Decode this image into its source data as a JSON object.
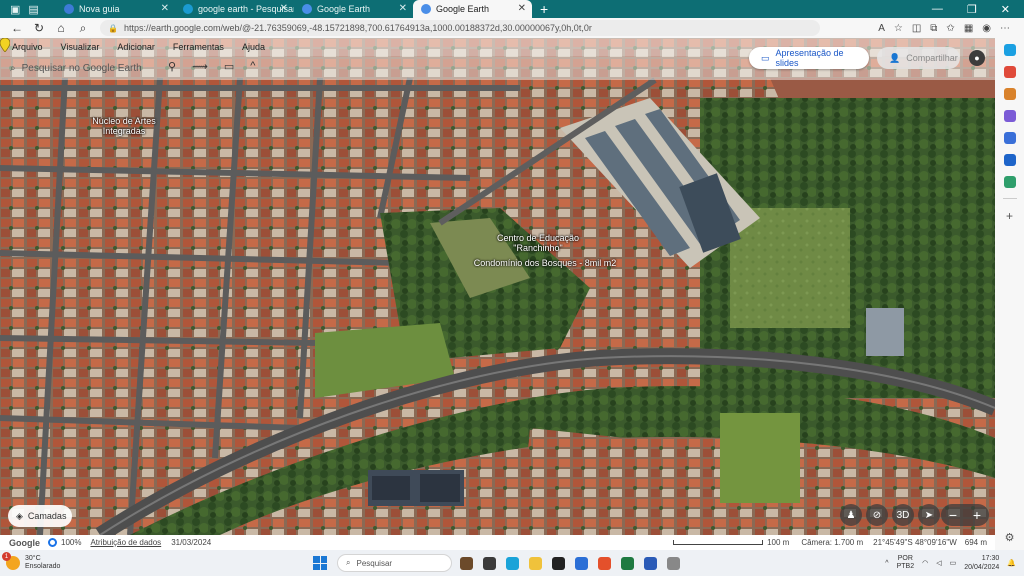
{
  "browser": {
    "tabs": [
      {
        "title": "Nova guia",
        "color": "#3d7bd6"
      },
      {
        "title": "google earth - Pesquisar",
        "color": "#1b9bd1"
      },
      {
        "title": "Google Earth",
        "color": "#4a8ee8"
      },
      {
        "title": "Google Earth",
        "color": "#4a8ee8"
      }
    ],
    "new_tab": "+",
    "url": "https://earth.google.com/web/@-21.76359069,-48.15721898,700.61764913a,1000.00188372d,30.00000067y,0h,0t,0r"
  },
  "earth": {
    "menu": [
      "Arquivo",
      "Visualizar",
      "Adicionar",
      "Ferramentas",
      "Ajuda"
    ],
    "search_placeholder": "Pesquisar no Google Earth",
    "slides_button": "Apresentação de slides",
    "share_button": "Compartilhar",
    "labels": {
      "nucleo": "Núcleo de Artes Integradas",
      "centro": "Centro de Educação \"Ranchinho\"",
      "condominio": "Condomínio dos Bosques - 8mil m2"
    },
    "layers_button": "Camadas",
    "controls": {
      "threed": "3D"
    },
    "status": {
      "logo": "Google",
      "percent": "100%",
      "attribution": "Atribuição de dados",
      "date": "31/03/2024",
      "scale_label": "100 m",
      "camera": "Câmera: 1.700 m",
      "coords": "21°45'49\"S 48°09'16\"W",
      "elevation": "694 m"
    }
  },
  "taskbar": {
    "weather_temp": "30°C",
    "weather_desc": "Ensolarado",
    "weather_badge": "1",
    "search_placeholder": "Pesquisar",
    "lang": "POR",
    "lang2": "PTB2",
    "time": "17:30",
    "date": "20/04/2024"
  }
}
